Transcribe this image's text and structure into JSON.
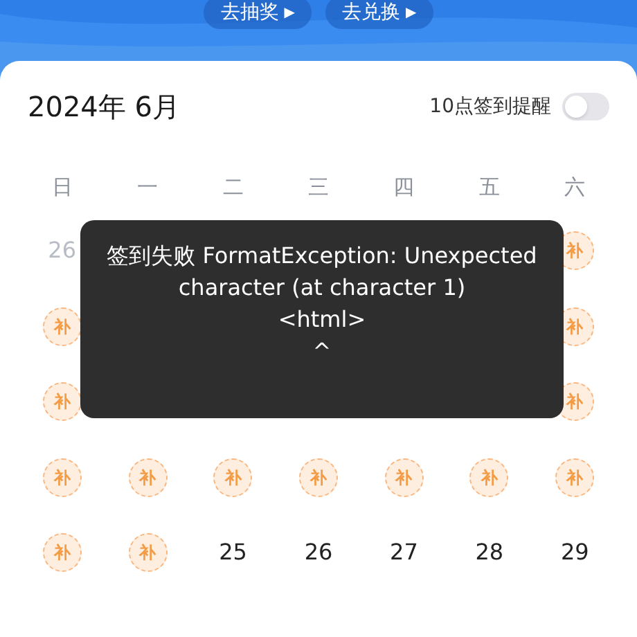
{
  "top_buttons": [
    {
      "label": "去抽奖",
      "icon": "▶"
    },
    {
      "label": "去兑换",
      "icon": "▶"
    }
  ],
  "calendar": {
    "title": "2024年 6月",
    "reminder": {
      "label": "10点签到提醒",
      "on": false
    },
    "weekdays": [
      "日",
      "一",
      "二",
      "三",
      "四",
      "五",
      "六"
    ],
    "weeks": [
      [
        {
          "kind": "other",
          "text": "26"
        },
        {
          "kind": "covered"
        },
        {
          "kind": "covered"
        },
        {
          "kind": "covered"
        },
        {
          "kind": "covered"
        },
        {
          "kind": "covered"
        },
        {
          "kind": "makeup",
          "text": "补"
        }
      ],
      [
        {
          "kind": "makeup",
          "text": "补"
        },
        {
          "kind": "covered"
        },
        {
          "kind": "covered"
        },
        {
          "kind": "covered"
        },
        {
          "kind": "covered"
        },
        {
          "kind": "covered"
        },
        {
          "kind": "makeup",
          "text": "补"
        }
      ],
      [
        {
          "kind": "makeup",
          "text": "补"
        },
        {
          "kind": "covered"
        },
        {
          "kind": "covered"
        },
        {
          "kind": "covered"
        },
        {
          "kind": "covered"
        },
        {
          "kind": "covered"
        },
        {
          "kind": "makeup",
          "text": "补"
        }
      ],
      [
        {
          "kind": "makeup",
          "text": "补"
        },
        {
          "kind": "makeup",
          "text": "补"
        },
        {
          "kind": "makeup",
          "text": "补"
        },
        {
          "kind": "makeup",
          "text": "补"
        },
        {
          "kind": "makeup",
          "text": "补"
        },
        {
          "kind": "makeup",
          "text": "补"
        },
        {
          "kind": "makeup",
          "text": "补"
        }
      ],
      [
        {
          "kind": "makeup",
          "text": "补"
        },
        {
          "kind": "makeup",
          "text": "补"
        },
        {
          "kind": "day",
          "text": "25"
        },
        {
          "kind": "day",
          "text": "26"
        },
        {
          "kind": "day",
          "text": "27"
        },
        {
          "kind": "day",
          "text": "28"
        },
        {
          "kind": "day",
          "text": "29"
        }
      ]
    ]
  },
  "toast": {
    "lines": [
      "签到失败 FormatException: Unexpected",
      "character (at character 1)",
      "<html>",
      "^"
    ]
  }
}
